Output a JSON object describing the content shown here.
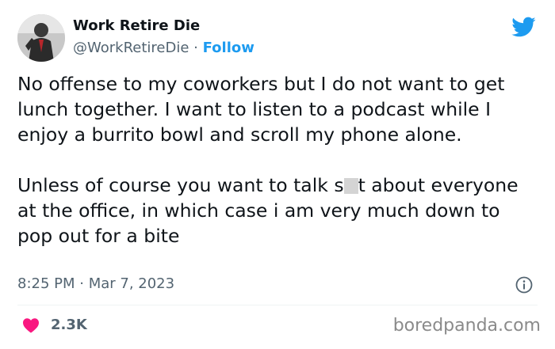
{
  "author": {
    "name": "Work Retire Die",
    "handle": "@WorkRetireDie",
    "separator": " · ",
    "follow_label": "Follow"
  },
  "tweet": {
    "paragraphs": [
      "No offense to my coworkers but I do not want to get lunch together. I want to listen to a podcast while I enjoy a burrito bowl and scroll my phone alone."
    ],
    "para2_before": "Unless of course you want to talk s",
    "para2_after": "t about everyone at the office, in which case i am very much down to pop out for a bite",
    "timestamp": "8:25 PM · Mar 7, 2023"
  },
  "engagement": {
    "likes": "2.3K"
  },
  "watermark": "boredpanda.com",
  "icons": {
    "brand": "twitter-bird-icon",
    "info": "info-icon",
    "like": "heart-icon"
  },
  "colors": {
    "accent": "#1d9bf0",
    "heart": "#f91880",
    "secondary_text": "#536471",
    "primary_text": "#0f1419"
  }
}
